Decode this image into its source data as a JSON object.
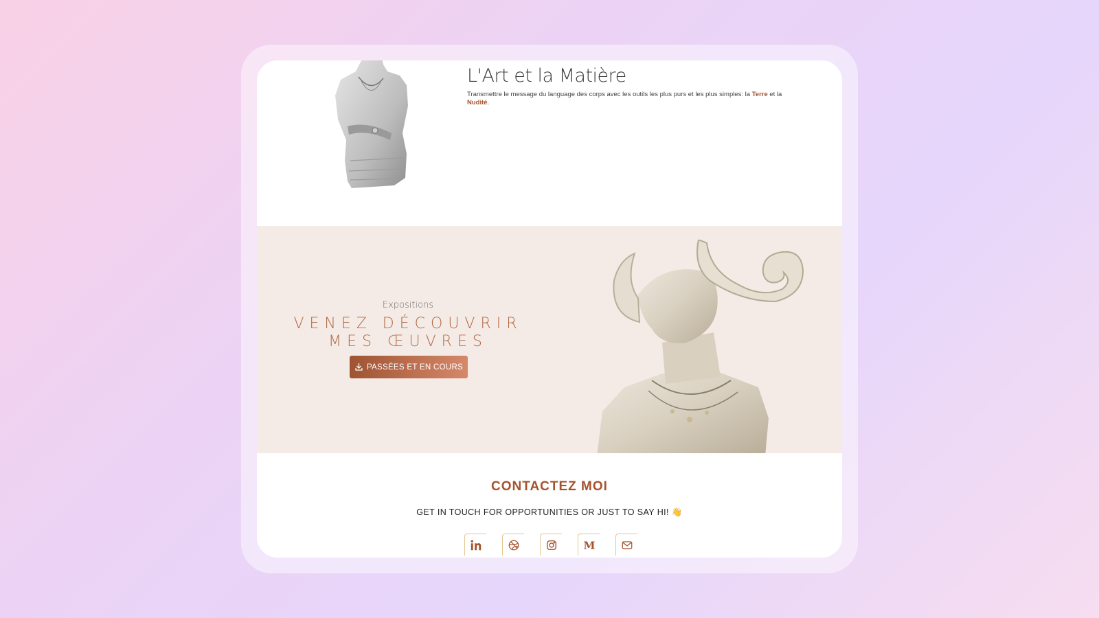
{
  "hero": {
    "title": "L'Art et la Matière",
    "text_before": "Transmettre le message du language des corps avec les outils les plus purs et les plus simples: la ",
    "em1": "Terre",
    "text_mid": " et la ",
    "em2": "Nudité",
    "text_end": "."
  },
  "expo": {
    "kicker": "Expositions",
    "title_line1": "VENEZ DÉCOUVRIR",
    "title_line2": "MES ŒUVRES",
    "button_label": "PASSÉES ET EN COURS"
  },
  "contact": {
    "title": "CONTACTEZ MOI",
    "subtitle": "GET IN TOUCH FOR OPPORTUNITIES OR JUST TO SAY HI! 👋"
  },
  "socials": [
    {
      "icon": "linkedin-icon"
    },
    {
      "icon": "dribbble-icon"
    },
    {
      "icon": "instagram-icon"
    },
    {
      "icon": "medium-icon"
    },
    {
      "icon": "mail-icon"
    }
  ],
  "colors": {
    "accent": "#a4532d",
    "section_bg": "#f5ebe6",
    "icon_border": "#e4c68f"
  }
}
